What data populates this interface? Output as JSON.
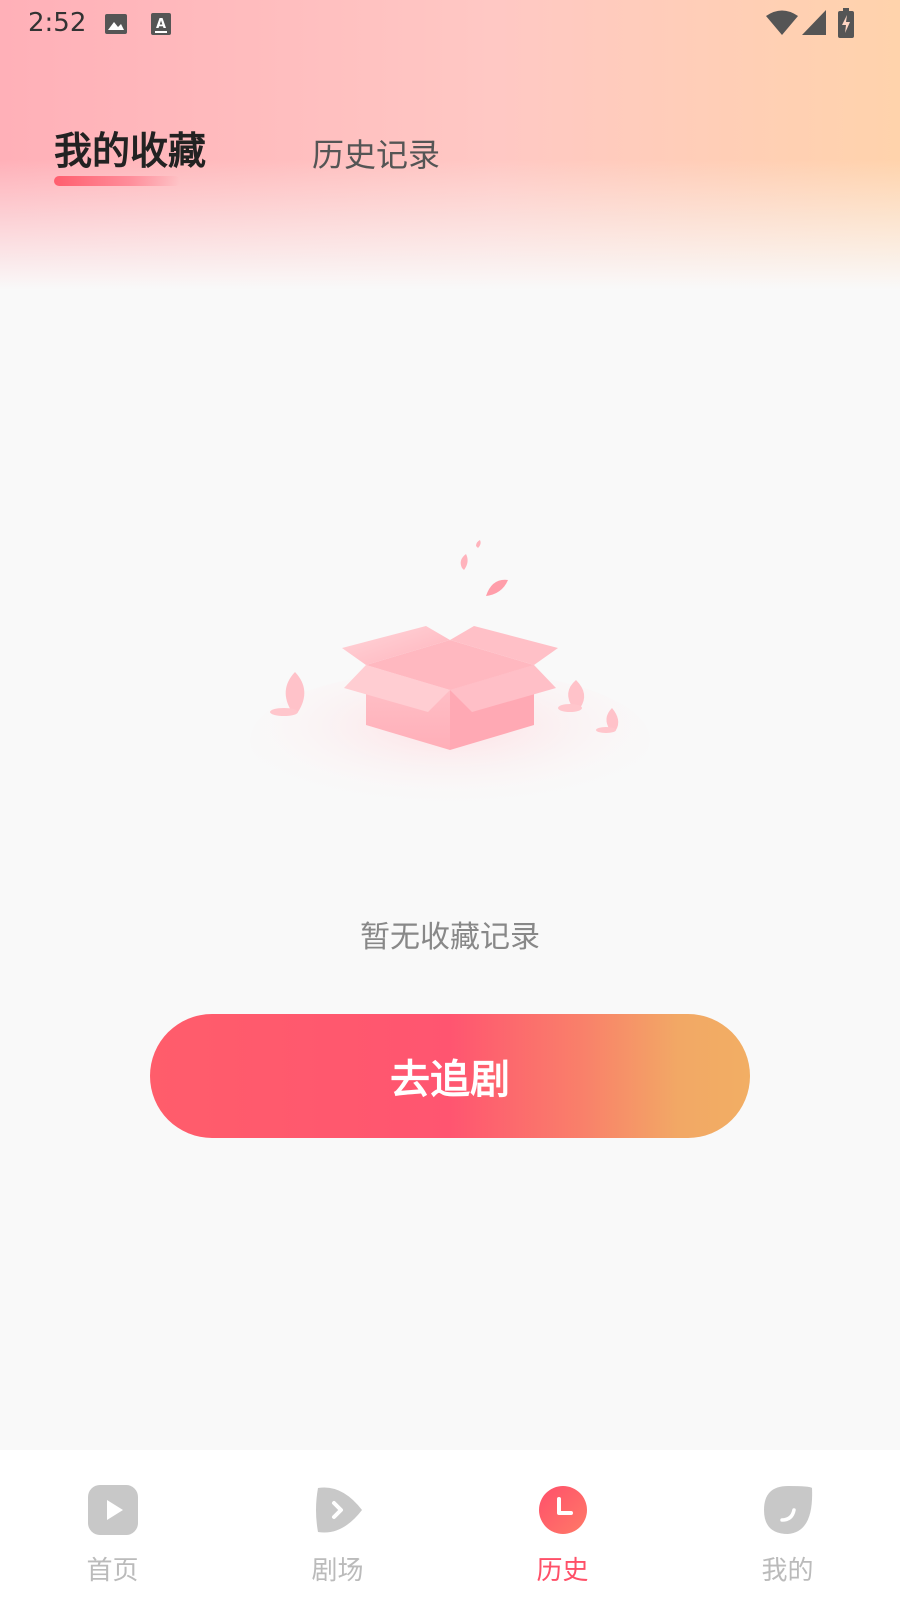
{
  "status_bar": {
    "time": "2:52",
    "icons": [
      "image-icon",
      "text-a-icon",
      "wifi-icon",
      "signal-icon",
      "battery-charging-icon"
    ]
  },
  "tabs": [
    {
      "label": "我的收藏",
      "active": true
    },
    {
      "label": "历史记录",
      "active": false
    }
  ],
  "empty_state": {
    "illustration": "open-box-icon",
    "message": "暂无收藏记录",
    "button_label": "去追剧"
  },
  "bottom_nav": [
    {
      "label": "首页",
      "icon": "play-square-icon",
      "active": false
    },
    {
      "label": "剧场",
      "icon": "theater-play-icon",
      "active": false
    },
    {
      "label": "历史",
      "icon": "clock-icon",
      "active": true
    },
    {
      "label": "我的",
      "icon": "profile-face-icon",
      "active": false
    }
  ],
  "colors": {
    "accent": "#ff5068",
    "inactive": "#bbbbbb",
    "button_start": "#ff5d6b",
    "button_end": "#f2ae64"
  }
}
